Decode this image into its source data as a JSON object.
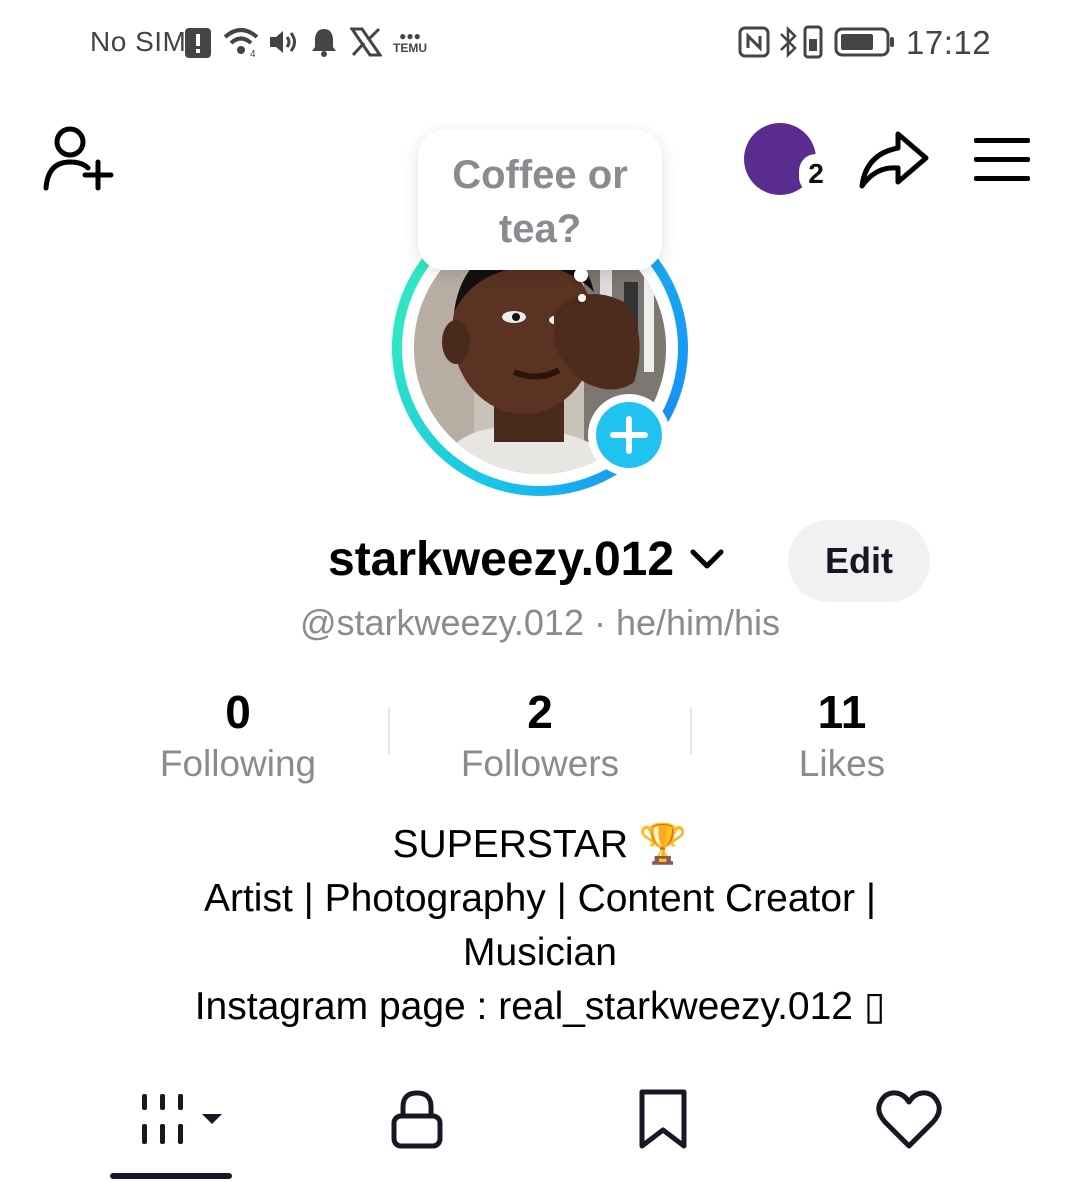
{
  "status_bar": {
    "carrier": "No SIM",
    "time": "17:12",
    "app_label": "TEMU"
  },
  "top_bar": {
    "notification_count": "2",
    "avatar_color": "#5b2c8f"
  },
  "note": {
    "text_line1": "Coffee or",
    "text_line2": "tea?"
  },
  "profile": {
    "username": "starkweezy.012",
    "edit_label": "Edit",
    "handle_line": "@starkweezy.012 · he/him/his",
    "ring_colors": [
      "#16c6e8",
      "#2ee6c4",
      "#1a8cf5"
    ],
    "plus_color": "#20c3f0"
  },
  "stats": [
    {
      "value": "0",
      "label": "Following"
    },
    {
      "value": "2",
      "label": "Followers"
    },
    {
      "value": "11",
      "label": "Likes"
    }
  ],
  "bio": {
    "line1": "SUPERSTAR 🏆",
    "line2": "Artist | Photography | Content Creator |",
    "line3": "Musician",
    "line4": "Instagram page : real_starkweezy.012 ▯"
  },
  "tabs": [
    {
      "name": "videos",
      "icon": "grid-icon",
      "active": true
    },
    {
      "name": "private",
      "icon": "lock-icon",
      "active": false
    },
    {
      "name": "favorites",
      "icon": "bookmark-icon",
      "active": false
    },
    {
      "name": "liked",
      "icon": "heart-icon",
      "active": false
    }
  ]
}
